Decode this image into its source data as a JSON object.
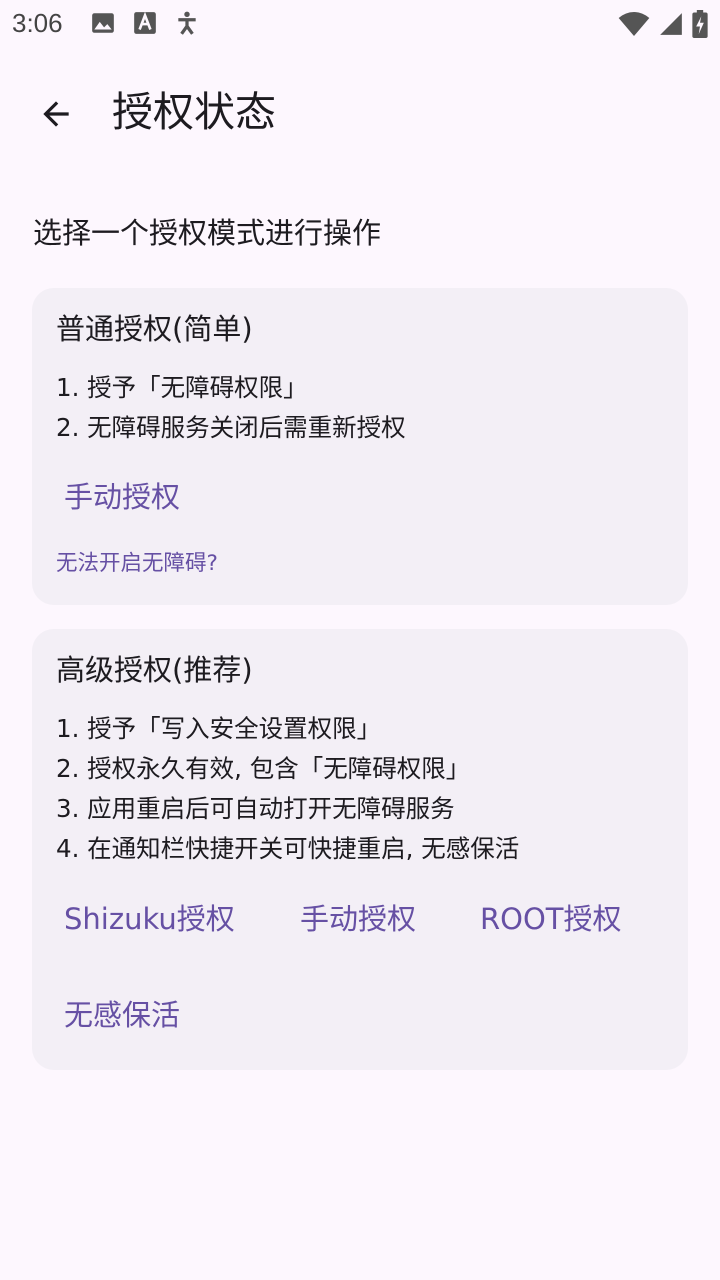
{
  "status_bar": {
    "time": "3:06",
    "left_icons": [
      "image-icon",
      "font-a-icon",
      "accessibility-icon"
    ],
    "right_icons": [
      "wifi-icon",
      "cell-signal-icon",
      "battery-charging-icon"
    ]
  },
  "app_bar": {
    "title": "授权状态"
  },
  "subtitle": "选择一个授权模式进行操作",
  "simple_card": {
    "title": "普通授权(简单)",
    "steps": [
      "1. 授予「无障碍权限」",
      "2. 无障碍服务关闭后需重新授权"
    ],
    "manual_button": "手动授权",
    "help_link": "无法开启无障碍?"
  },
  "advanced_card": {
    "title": "高级授权(推荐)",
    "steps": [
      "1. 授予「写入安全设置权限」",
      "2. 授权永久有效, 包含「无障碍权限」",
      "3. 应用重启后可自动打开无障碍服务",
      "4. 在通知栏快捷开关可快捷重启, 无感保活"
    ],
    "shizuku_button": "Shizuku授权",
    "manual_button": "手动授权",
    "root_button": "ROOT授权",
    "keepalive_button": "无感保活"
  },
  "colors": {
    "background": "#fdf7fe",
    "card": "#f3eff6",
    "accent": "#6650a4",
    "text": "#1d1b20"
  }
}
